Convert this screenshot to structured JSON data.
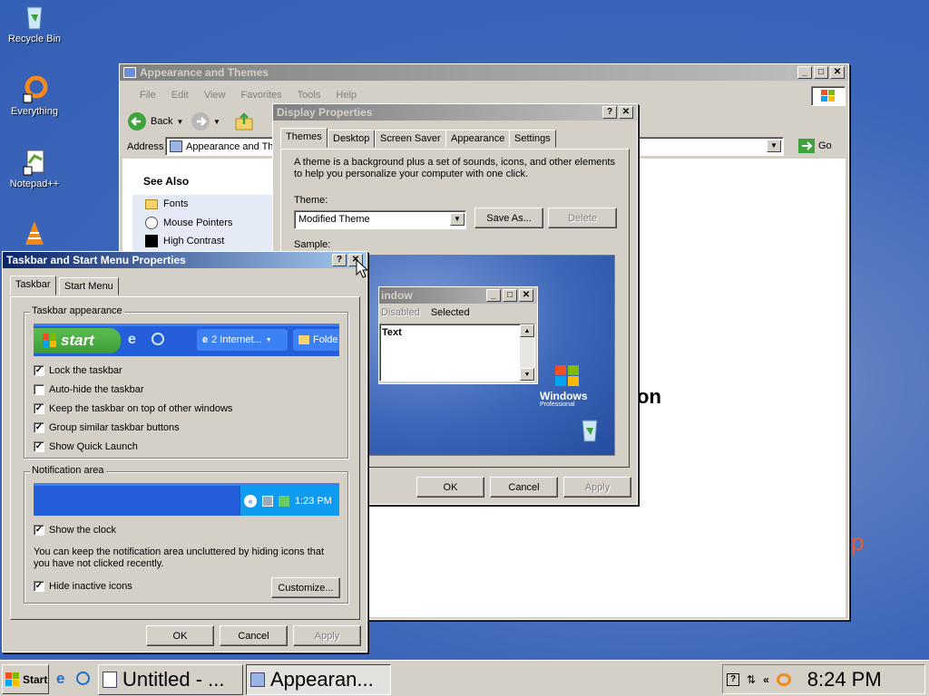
{
  "desktop": {
    "icons": [
      {
        "label": "Recycle Bin"
      },
      {
        "label": "Everything"
      },
      {
        "label": "Notepad++"
      },
      {
        "label": ""
      }
    ],
    "bg_text_on": "on",
    "bg_text_p": "p"
  },
  "explorer": {
    "title": "Appearance and Themes",
    "menu": [
      "File",
      "Edit",
      "View",
      "Favorites",
      "Tools",
      "Help"
    ],
    "back_label": "Back",
    "address_label": "Address",
    "address_value": "Appearance and Th",
    "go_label": "Go",
    "see_also_title": "See Also",
    "see_also_items": [
      "Fonts",
      "Mouse Pointers",
      "High Contrast"
    ]
  },
  "display": {
    "title": "Display Properties",
    "tabs": [
      "Themes",
      "Desktop",
      "Screen Saver",
      "Appearance",
      "Settings"
    ],
    "description": "A theme is a background plus a set of sounds, icons, and other elements to help you personalize your computer with one click.",
    "theme_label": "Theme:",
    "theme_value": "Modified Theme",
    "save_as": "Save As...",
    "delete": "Delete",
    "sample_label": "Sample:",
    "sample_window_title": "indow",
    "sample_menu": [
      "Disabled",
      "Selected"
    ],
    "sample_text": "Text",
    "windows_logo_text": "Windows",
    "windows_logo_sub": "Professional",
    "ok": "OK",
    "cancel": "Cancel",
    "apply": "Apply"
  },
  "taskbar_props": {
    "title": "Taskbar and Start Menu Properties",
    "tabs": [
      "Taskbar",
      "Start Menu"
    ],
    "appearance_group": "Taskbar appearance",
    "preview_start": "start",
    "preview_ie": "2 Internet...",
    "preview_folder": "Folde",
    "options": [
      {
        "label": "Lock the taskbar",
        "checked": true
      },
      {
        "label": "Auto-hide the taskbar",
        "checked": false
      },
      {
        "label": "Keep the taskbar on top of other windows",
        "checked": true
      },
      {
        "label": "Group similar taskbar buttons",
        "checked": true
      },
      {
        "label": "Show Quick Launch",
        "checked": true
      }
    ],
    "notification_group": "Notification area",
    "notif_time": "1:23 PM",
    "show_clock": "Show the clock",
    "notif_desc": "You can keep the notification area uncluttered by hiding icons that you have not clicked recently.",
    "hide_inactive": "Hide inactive icons",
    "customize": "Customize...",
    "ok": "OK",
    "cancel": "Cancel",
    "apply": "Apply"
  },
  "taskbar": {
    "start": "Start",
    "tasks": [
      "Untitled - ...",
      "Appearan..."
    ],
    "clock": "8:24 PM"
  },
  "colors": {
    "xp_blue": "#245edb",
    "start_green": "#3c9e35",
    "title_active": "#0a246a"
  }
}
